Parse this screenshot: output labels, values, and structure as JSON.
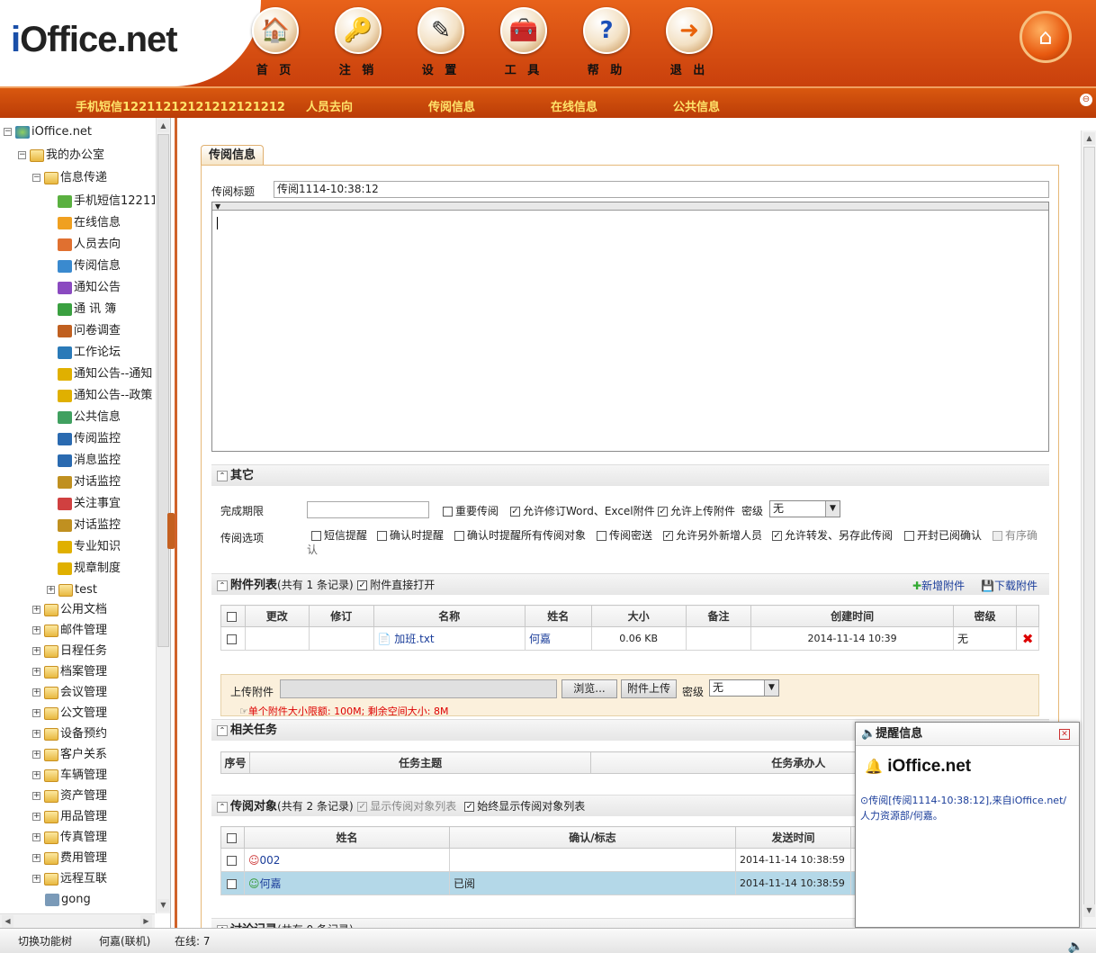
{
  "app": {
    "logo_prefix": "i",
    "logo_rest": "Office.net"
  },
  "nav": [
    {
      "label": "首 页",
      "icon": "house-icon",
      "glyph": "🏠"
    },
    {
      "label": "注 销",
      "icon": "key-icon",
      "glyph": "🔑"
    },
    {
      "label": "设 置",
      "icon": "settings-pen-icon",
      "glyph": "✎"
    },
    {
      "label": "工 具",
      "icon": "toolbox-icon",
      "glyph": "🧰"
    },
    {
      "label": "帮 助",
      "icon": "help-icon",
      "glyph": "?"
    },
    {
      "label": "退 出",
      "icon": "exit-arrow-icon",
      "glyph": "➜"
    }
  ],
  "quickbar": [
    "手机短信12211212121212121212",
    "人员去向",
    "传阅信息",
    "在线信息",
    "公共信息"
  ],
  "tree": {
    "root": "iOffice.net",
    "office": "我的办公室",
    "info": "信息传递",
    "items": [
      "手机短信12211",
      "在线信息",
      "人员去向",
      "传阅信息",
      "通知公告",
      "通 讯 簿",
      "问卷调查",
      "工作论坛",
      "通知公告--通知",
      "通知公告--政策",
      "公共信息",
      "传阅监控",
      "消息监控",
      "对话监控",
      "关注事宜",
      "对话监控",
      "专业知识",
      "规章制度",
      "test"
    ],
    "groups": [
      "公用文档",
      "邮件管理",
      "日程任务",
      "档案管理",
      "会议管理",
      "公文管理",
      "设备预约",
      "客户关系",
      "车辆管理",
      "资产管理",
      "用品管理",
      "传真管理",
      "费用管理",
      "远程互联",
      "gong"
    ]
  },
  "form": {
    "tab": "传阅信息",
    "title_label": "传阅标题",
    "title_value": "传阅1114-10:38:12",
    "other_section": "其它",
    "deadline_label": "完成期限",
    "options_label": "传阅选项",
    "row1_opts": [
      {
        "t": "重要传阅",
        "on": false
      },
      {
        "t": "允许修订Word、Excel附件",
        "on": true
      },
      {
        "t": "允许上传附件",
        "on": true
      }
    ],
    "secret_label": "密级",
    "secret_value": "无",
    "row2_opts": [
      {
        "t": "短信提醒",
        "on": false
      },
      {
        "t": "确认时提醒",
        "on": false
      },
      {
        "t": "确认时提醒所有传阅对象",
        "on": false
      },
      {
        "t": "传阅密送",
        "on": false
      },
      {
        "t": "允许另外新增人员",
        "on": true
      },
      {
        "t": "允许转发、另存此传阅",
        "on": true
      },
      {
        "t": "开封已阅确认",
        "on": false
      },
      {
        "t": "有序确",
        "on": false,
        "disabled": true
      }
    ],
    "row2_wrap": "认"
  },
  "attachments": {
    "title": "附件列表",
    "count": "(共有 1 条记录)",
    "direct_open": "附件直接打开",
    "add": "新增附件",
    "download": "下载附件",
    "headers": [
      "更改",
      "修订",
      "名称",
      "姓名",
      "大小",
      "备注",
      "创建时间",
      "密级"
    ],
    "rows": [
      {
        "name": "加班.txt",
        "owner": "何嘉",
        "size": "0.06 KB",
        "note": "",
        "created": "2014-11-14 10:39",
        "secret": "无"
      }
    ],
    "upload_label": "上传附件",
    "browse": "浏览...",
    "upload_btn": "附件上传",
    "upload_secret": "密级",
    "upload_secret_value": "无",
    "limit_note": "单个附件大小限额: 100M; 剩余空间大小: 8M"
  },
  "tasks": {
    "title": "相关任务",
    "headers": [
      "序号",
      "任务主题",
      "任务承办人"
    ]
  },
  "targets": {
    "title": "传阅对象",
    "count": "(共有 2 条记录)",
    "show_list": "显示传阅对象列表",
    "always_show": "始终显示传阅对象列表",
    "headers": [
      "姓名",
      "确认/标志",
      "发送时间"
    ],
    "rows": [
      {
        "name": "002",
        "status": "",
        "time": "2014-11-14 10:38:59"
      },
      {
        "name": "何嘉",
        "status": "已阅",
        "time": "2014-11-14 10:38:59"
      }
    ]
  },
  "discussion": {
    "title": "讨论记录",
    "count": "(共有 0 条记录)"
  },
  "notify": {
    "title": "提醒信息",
    "logo": "iOffice.net",
    "message": "⊙传阅[传阅1114-10:38:12],来自iOffice.net/人力资源部/何嘉。"
  },
  "status": {
    "switch": "切换功能树",
    "user": "何嘉(联机)",
    "online": "在线: 7"
  }
}
